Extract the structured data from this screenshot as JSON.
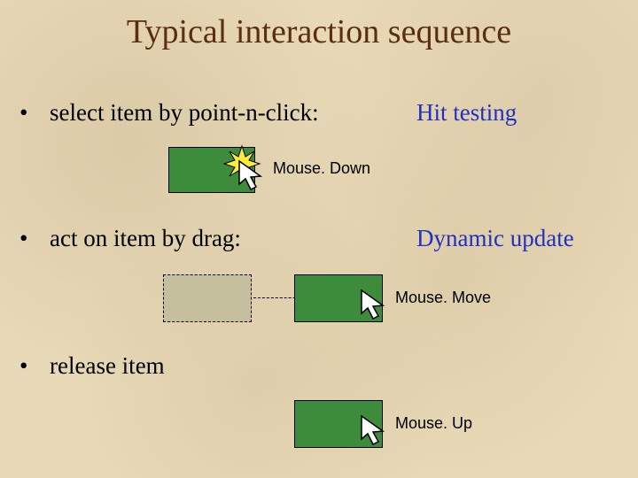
{
  "title": "Typical interaction sequence",
  "bullets": {
    "b1": "select item by point-n-click:",
    "b2": "act on item by drag:",
    "b3": "release item"
  },
  "side_labels": {
    "s1": "Hit testing",
    "s2": "Dynamic update"
  },
  "events": {
    "e1": "Mouse. Down",
    "e2": "Mouse. Move",
    "e3": "Mouse. Up"
  },
  "colors": {
    "green": "#3c8c3c",
    "side": "#2030c0",
    "title": "#5a2e0e",
    "star": "#ffec3a"
  }
}
